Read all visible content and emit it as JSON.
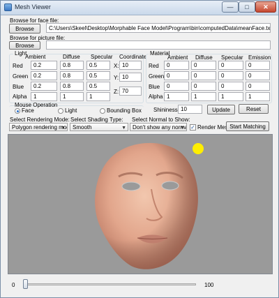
{
  "window": {
    "title": "Mesh Viewer",
    "controls": {
      "minimize": "—",
      "maximize": "□",
      "close": "✕"
    }
  },
  "face_file": {
    "label": "Browse for face file:",
    "button": "Browse",
    "path": "C:\\Users\\Skeel\\Desktop\\Morphable Face Model\\Program\\bin\\computedData\\meanFace.txt"
  },
  "picture_file": {
    "label": "Browse for picture file:",
    "button": "Browse",
    "path": ""
  },
  "light": {
    "title": "Light",
    "columns": [
      "Ambient",
      "Diffuse",
      "Specular"
    ],
    "rows": [
      {
        "label": "Red",
        "values": [
          "0.2",
          "0.8",
          "0.5"
        ]
      },
      {
        "label": "Green",
        "values": [
          "0.2",
          "0.8",
          "0.5"
        ]
      },
      {
        "label": "Blue",
        "values": [
          "0.2",
          "0.8",
          "0.5"
        ]
      },
      {
        "label": "Alpha",
        "values": [
          "1",
          "1",
          "1"
        ]
      }
    ],
    "coordinate_label": "Coordinate",
    "coordinates": [
      {
        "label": "X:",
        "value": "10"
      },
      {
        "label": "Y:",
        "value": "10"
      },
      {
        "label": "Z:",
        "value": "70"
      }
    ]
  },
  "material": {
    "title": "Material",
    "columns": [
      "Ambient",
      "Diffuse",
      "Specular",
      "Emission"
    ],
    "rows": [
      {
        "label": "Red",
        "values": [
          "0",
          "0",
          "0",
          "0"
        ]
      },
      {
        "label": "Green",
        "values": [
          "0",
          "0",
          "0",
          "0"
        ]
      },
      {
        "label": "Blue",
        "values": [
          "0",
          "0",
          "0",
          "0"
        ]
      },
      {
        "label": "Alpha",
        "values": [
          "1",
          "1",
          "1",
          "1"
        ]
      }
    ]
  },
  "mouse_operation": {
    "title": "Mouse Operation",
    "options": [
      "Face",
      "Light",
      "Bounding Box"
    ],
    "selected": "Face"
  },
  "shininess": {
    "label": "Shininess:",
    "value": "10"
  },
  "update_button": "Update",
  "reset_button": "Reset",
  "rendering_mode": {
    "label": "Select Rendering Mode:",
    "value": "Polygon rendering mode"
  },
  "shading_type": {
    "label": "Select Shading Type:",
    "value": "Smooth"
  },
  "normal_show": {
    "label": "Select Normal to Show:",
    "value": "Don't show any normals"
  },
  "render_mesh": {
    "label": "Render Mesh",
    "checked": true
  },
  "start_matching_button": "Start Matching",
  "viewport": {
    "background": "#9a9a9a",
    "light_color": "#ffee00"
  },
  "slider": {
    "min": "0",
    "max": "100",
    "value": 0
  },
  "colors": {
    "window_bg": "#f0f0f0",
    "accent": "#2a6fc9"
  }
}
